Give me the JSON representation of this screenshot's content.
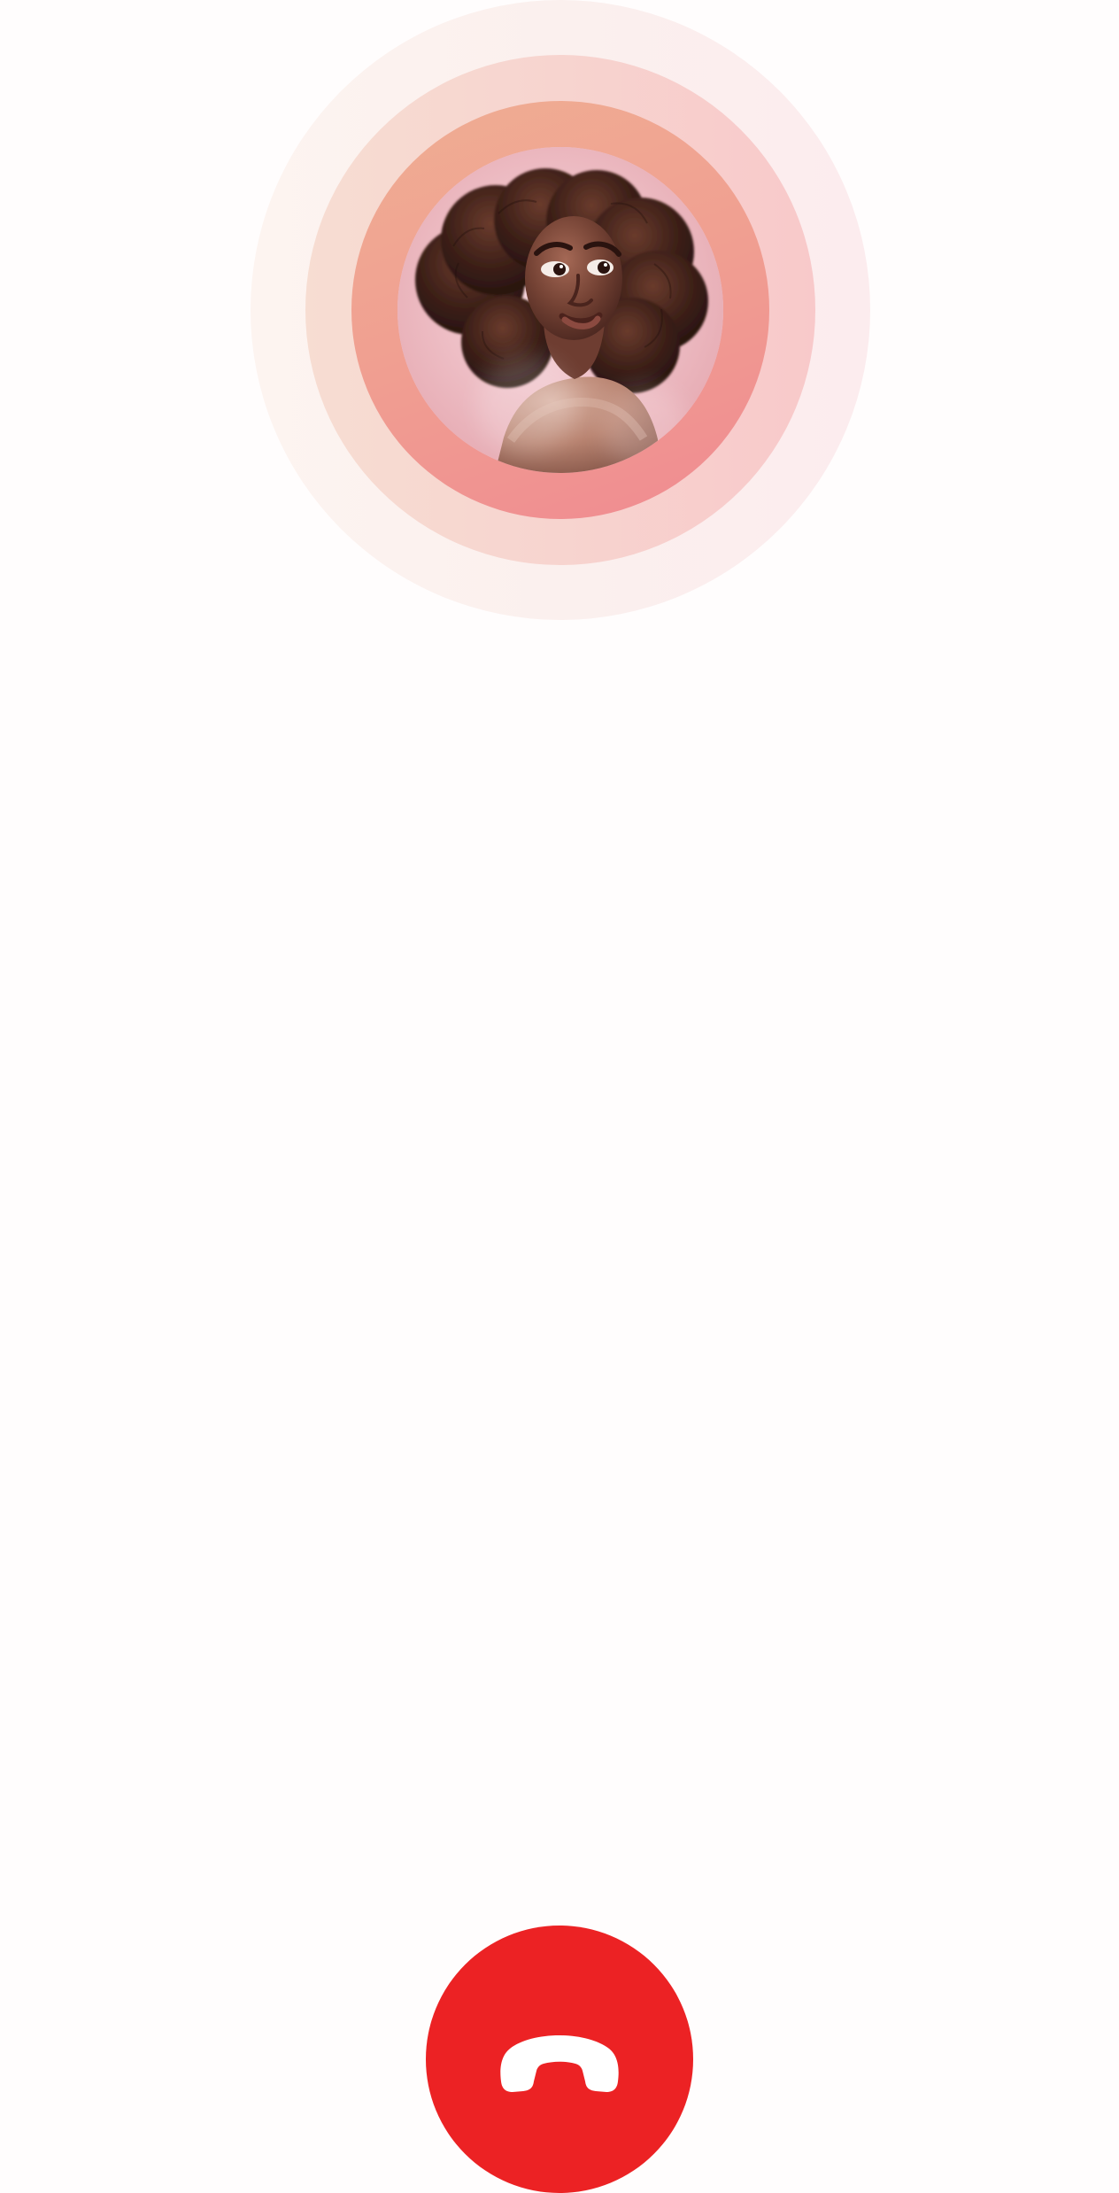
{
  "call_screen": {
    "background_color": "#fffdfd",
    "contact_avatar": {
      "icon": "person-portrait-image",
      "ring_colors": [
        "#fdf1ee",
        "#f7d5cf",
        "#f0a090"
      ]
    },
    "end_call_button": {
      "icon": "hang-up-icon",
      "color": "#ec2224"
    }
  }
}
